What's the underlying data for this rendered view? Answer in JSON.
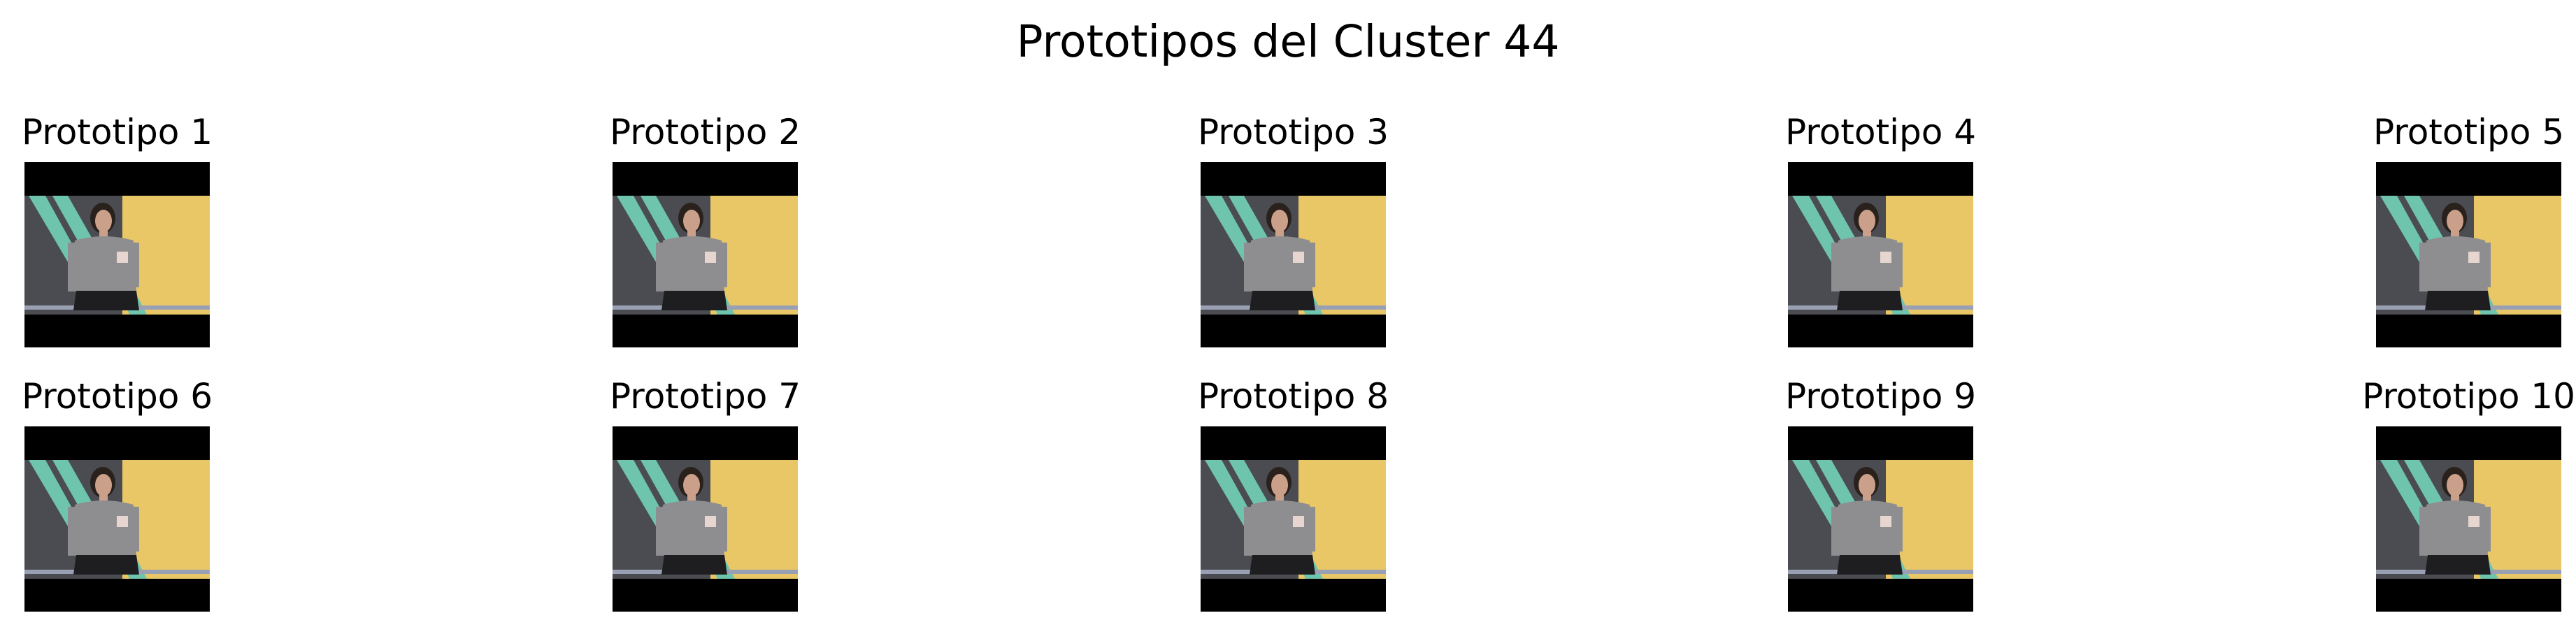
{
  "figure": {
    "title": "Prototipos del Cluster 44"
  },
  "prototypes": [
    {
      "label": "Prototipo 1"
    },
    {
      "label": "Prototipo 2"
    },
    {
      "label": "Prototipo 3"
    },
    {
      "label": "Prototipo 4"
    },
    {
      "label": "Prototipo 5"
    },
    {
      "label": "Prototipo 6"
    },
    {
      "label": "Prototipo 7"
    },
    {
      "label": "Prototipo 8"
    },
    {
      "label": "Prototipo 9"
    },
    {
      "label": "Prototipo 10"
    }
  ],
  "thumbnail_colors": {
    "letterbox": "#000000",
    "backdrop_left": "#4a4c51",
    "backdrop_right": "#e9c766",
    "accent_stripes": "#6fc4ad",
    "sweater": "#8e8e90",
    "skin": "#caa08a",
    "hair": "#2a211c",
    "skirt": "#1e1e20",
    "floor": "#9aa0b4"
  }
}
